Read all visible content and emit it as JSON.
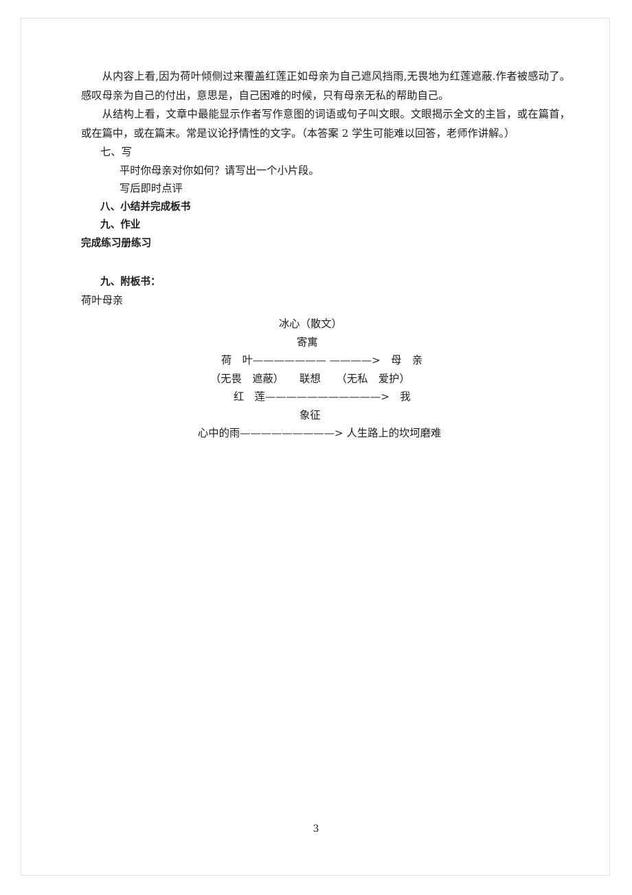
{
  "document": {
    "page_number": "3",
    "paragraphs": [
      "从内容上看,因为荷叶倾侧过来覆盖红莲正如母亲为自己遮风挡雨,无畏地为红莲遮蔽.作者被感动了。感叹母亲为自己的付出，意思是，自己困难的时候，只有母亲无私的帮助自己。",
      "从结构上看，文章中最能显示作者写作意图的词语或句子叫文眼。文眼揭示全文的主旨，或在篇首，或在篇中，或在篇末。常是议论抒情性的文字。（本答案 2 学生可能难以回答，老师作讲解。）"
    ],
    "outline": [
      {
        "text": "七、写",
        "indent": 1,
        "bold": false
      },
      {
        "text": "平时你母亲对你如何？请写出一个小片段。",
        "indent": 2,
        "bold": false
      },
      {
        "text": "写后即时点评",
        "indent": 2,
        "bold": false
      },
      {
        "text": "八、小结并完成板书",
        "indent": 1,
        "bold": true
      },
      {
        "text": "九、作业",
        "indent": 1,
        "bold": true
      },
      {
        "text": "完成练习册练习",
        "indent": 0,
        "bold": true
      }
    ],
    "board_heading": [
      {
        "text": "九、附板书：",
        "indent": 1,
        "bold": true
      },
      {
        "text": "荷叶母亲",
        "indent": 0,
        "bold": false
      }
    ],
    "board": {
      "title": "冰心（散文）",
      "subtitle": "寄寓",
      "row1": "荷　叶——————— ————>　母　亲",
      "row2": "（无畏　遮蔽）　　联想　　（无私　爱护）",
      "row3": "红　莲———————————>　我",
      "row4": "象征",
      "row5": "心中的雨—————————> 人生路上的坎坷磨难"
    }
  }
}
